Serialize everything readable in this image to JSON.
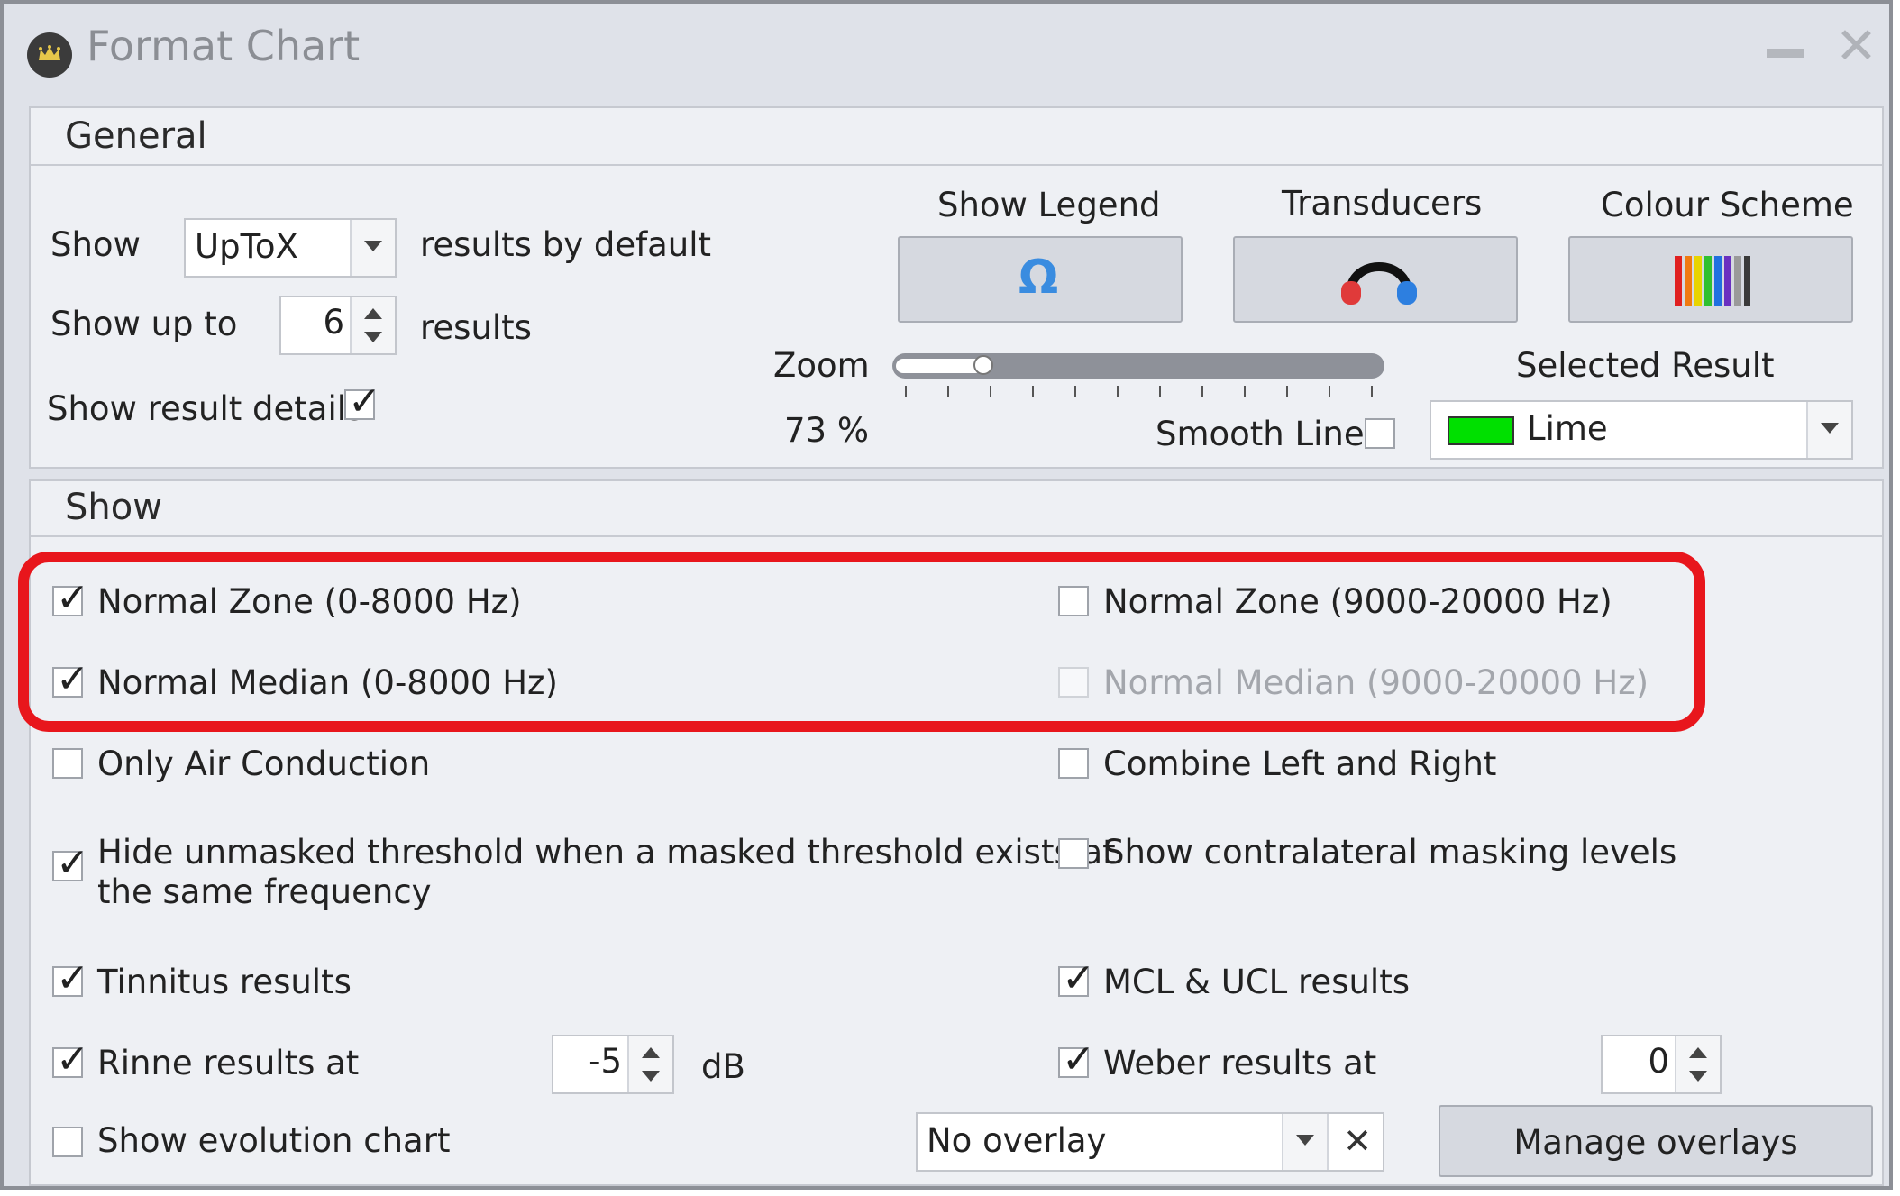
{
  "window": {
    "title": "Format Chart"
  },
  "general": {
    "header": "General",
    "show_label": "Show",
    "show_combo_value": "UpToX",
    "show_suffix": "results by default",
    "showupto_label": "Show up to",
    "showupto_value": "6",
    "showupto_suffix": "results",
    "show_details_label": "Show result details",
    "show_details_checked": true,
    "show_legend_label": "Show Legend",
    "transducers_label": "Transducers",
    "colour_scheme_label": "Colour Scheme",
    "zoom_label": "Zoom",
    "zoom_value": "73 %",
    "zoom_fraction": 0.73,
    "smooth_lines_label": "Smooth Lines",
    "smooth_lines_checked": false,
    "selected_result_label": "Selected Result",
    "selected_result_value": "Lime",
    "selected_result_color": "#00e000"
  },
  "show": {
    "header": "Show",
    "normal_zone_low": "Normal Zone (0-8000 Hz)",
    "normal_zone_high": "Normal Zone (9000-20000 Hz)",
    "normal_median_low": "Normal Median (0-8000 Hz)",
    "normal_median_high": "Normal Median (9000-20000 Hz)",
    "only_air": "Only Air Conduction",
    "combine_lr": "Combine Left and Right",
    "hide_unmasked_line1": "Hide unmasked threshold when a masked threshold exists at",
    "hide_unmasked_line2": "the same frequency",
    "contralateral": "Show contralateral masking levels",
    "tinnitus": "Tinnitus results",
    "mcl_ucl": "MCL & UCL results",
    "rinne": "Rinne results at",
    "rinne_value": "-5",
    "rinne_unit": "dB",
    "weber": "Weber results at",
    "weber_value": "0",
    "evolution": "Show evolution chart",
    "overlay_value": "No overlay",
    "manage_overlays": "Manage overlays"
  },
  "colors": {
    "highlight": "#e8161c",
    "lime": "#00e000"
  }
}
